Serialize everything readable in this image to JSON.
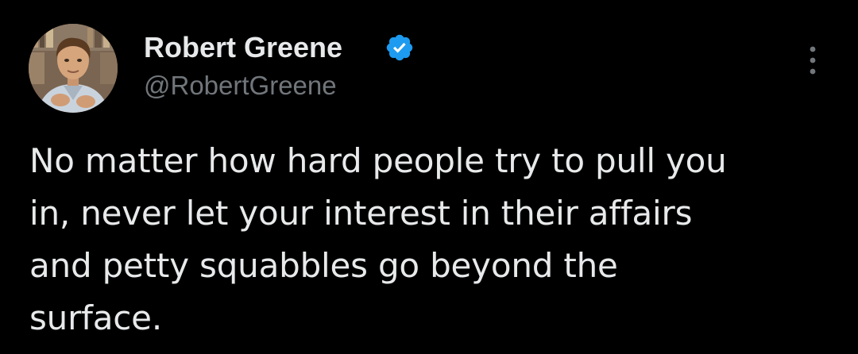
{
  "author": {
    "display_name": "Robert Greene",
    "handle": "@RobertGreene",
    "verified": true,
    "avatar_icon": "profile-photo",
    "verified_icon": "verified-badge-icon",
    "verified_color": "#1d9bf0"
  },
  "tweet": {
    "text": "No matter how hard people try to pull you\nin, never let your interest in their affairs\nand petty squabbles go beyond the\nsurface."
  },
  "menu": {
    "icon": "more-options-icon"
  },
  "colors": {
    "background": "#000000",
    "text_primary": "#e7e9ea",
    "text_secondary": "#71767b"
  }
}
